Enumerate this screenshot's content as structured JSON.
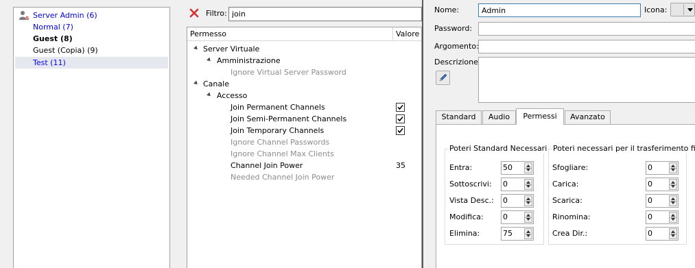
{
  "groups": [
    {
      "label": "Server Admin (6)",
      "style": "blue",
      "icon": "server-admin-group-icon"
    },
    {
      "label": "Normal (7)",
      "style": "blue"
    },
    {
      "label": "Guest (8)",
      "style": "bold"
    },
    {
      "label": "Guest (Copia) (9)",
      "style": "normal"
    },
    {
      "label": "Test (11)",
      "style": "blue",
      "selected": true
    }
  ],
  "filter": {
    "label": "Filtro:",
    "value": "join",
    "clear_icon": "clear-filter-icon",
    "clear_color": "#d32f2f"
  },
  "permissions_tree": {
    "columns": [
      "Permesso",
      "Valore"
    ],
    "rows": [
      {
        "label": "Server Virtuale",
        "level": 0,
        "expanded": true
      },
      {
        "label": "Amministrazione",
        "level": 1,
        "expanded": true
      },
      {
        "label": "Ignore Virtual Server Password",
        "level": 2,
        "disabled": true
      },
      {
        "label": "Canale",
        "level": 0,
        "expanded": true
      },
      {
        "label": "Accesso",
        "level": 1,
        "expanded": true
      },
      {
        "label": "Join Permanent Channels",
        "level": 2,
        "checked": true
      },
      {
        "label": "Join Semi-Permanent Channels",
        "level": 2,
        "checked": true
      },
      {
        "label": "Join Temporary Channels",
        "level": 2,
        "checked": true
      },
      {
        "label": "Ignore Channel Passwords",
        "level": 2,
        "disabled": true
      },
      {
        "label": "Ignore Channel Max Clients",
        "level": 2,
        "disabled": true
      },
      {
        "label": "Channel Join Power",
        "level": 2,
        "value": "35"
      },
      {
        "label": "Needed Channel Join Power",
        "level": 2,
        "disabled": true
      }
    ]
  },
  "dialog": {
    "nome_label": "Nome:",
    "nome_value": "Admin",
    "icona_label": "Icona:",
    "password_label": "Password:",
    "password_value": "",
    "argomento_label": "Argomento:",
    "argomento_value": "",
    "descrizione_label": "Descrizione:",
    "descrizione_value": "",
    "edit_icon": "pencil-icon",
    "tabs": [
      "Standard",
      "Audio",
      "Permessi",
      "Avanzato"
    ],
    "active_tab": "Permessi",
    "standard_powers": {
      "title": "Poteri Standard Necessari",
      "fields": [
        {
          "label": "Entra:",
          "value": "50"
        },
        {
          "label": "Sottoscrivi:",
          "value": "0"
        },
        {
          "label": "Vista Desc.:",
          "value": "0"
        },
        {
          "label": "Modifica:",
          "value": "0"
        },
        {
          "label": "Elimina:",
          "value": "75"
        }
      ]
    },
    "transfer_powers": {
      "title": "Poteri necessari per il trasferimento file",
      "fields": [
        {
          "label": "Sfogliare:",
          "value": "0"
        },
        {
          "label": "Carica:",
          "value": "0"
        },
        {
          "label": "Scarica:",
          "value": "0"
        },
        {
          "label": "Rinomina:",
          "value": "0"
        },
        {
          "label": "Crea Dir.:",
          "value": "0"
        }
      ]
    }
  },
  "colors": {
    "link_blue": "#0000e0",
    "disabled_gray": "#8c8c8c",
    "selection": "#e5e9ef"
  }
}
